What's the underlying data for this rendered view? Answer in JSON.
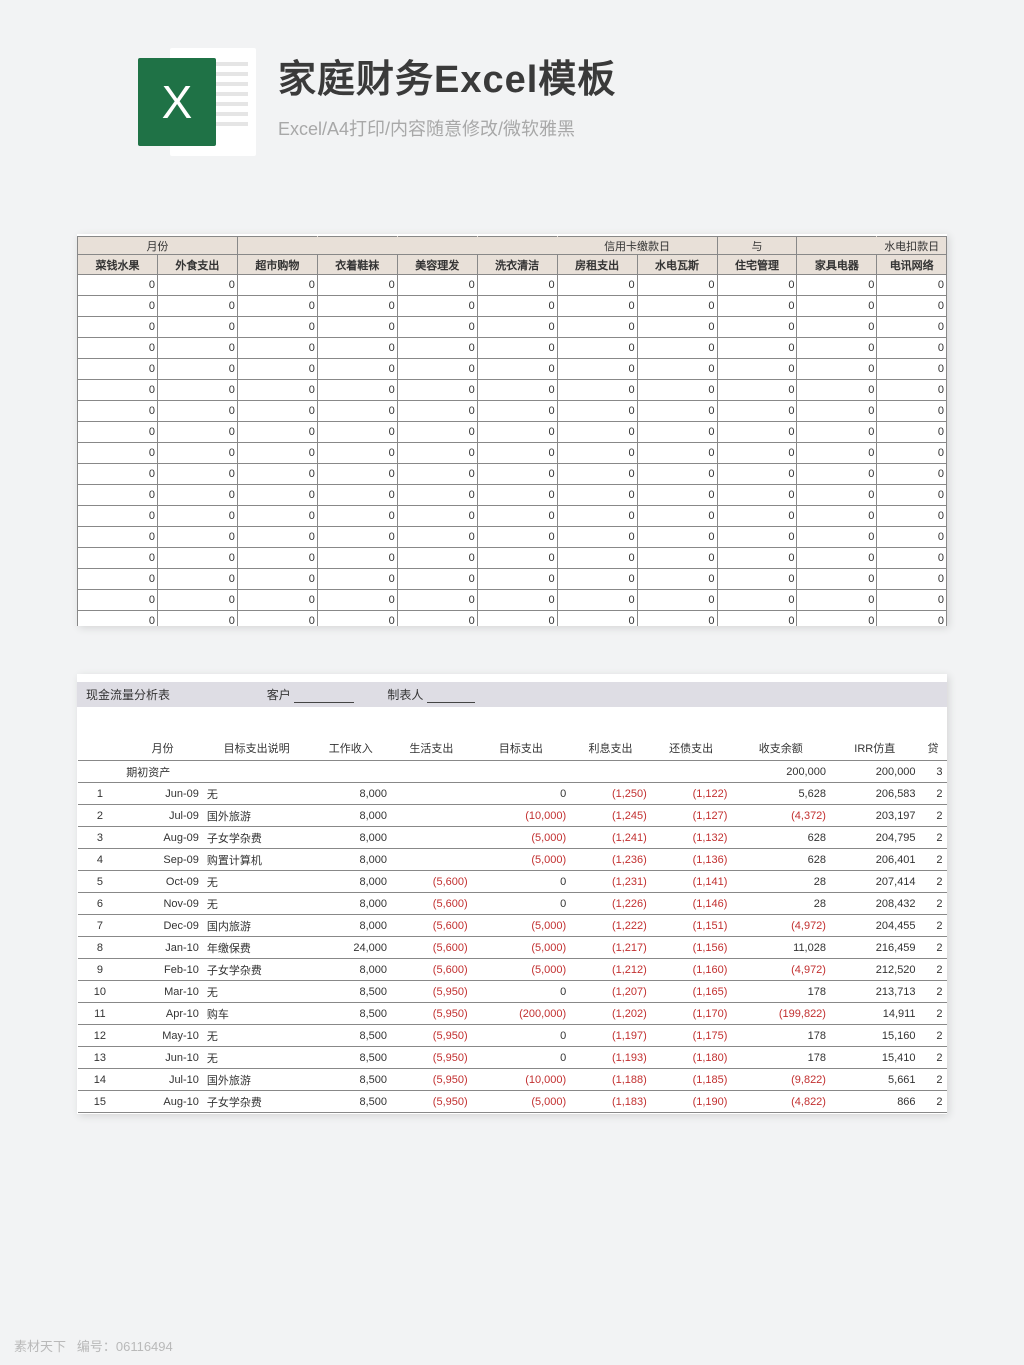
{
  "header": {
    "title": "家庭财务Excel模板",
    "subtitle": "Excel/A4打印/内容随意修改/微软雅黑"
  },
  "sheet1": {
    "top_labels": {
      "month": "月份",
      "credit_due": "信用卡缴款日",
      "and": "与",
      "util_due": "水电扣款日"
    },
    "columns": [
      "菜钱水果",
      "外食支出",
      "超市购物",
      "衣着鞋袜",
      "美容理发",
      "洗衣清洁",
      "房租支出",
      "水电瓦斯",
      "住宅管理",
      "家具电器",
      "电讯网络"
    ],
    "rows": 17,
    "cell_value": "0"
  },
  "sheet2": {
    "title": "现金流量分析表",
    "client_label": "客户",
    "maker_label": "制表人",
    "columns": [
      "",
      "月份",
      "目标支出说明",
      "工作收入",
      "生活支出",
      "目标支出",
      "利息支出",
      "还债支出",
      "收支余额",
      "IRR仿直",
      "贷"
    ],
    "initial_row": {
      "label": "期初资产",
      "balance": "200,000",
      "irr": "200,000",
      "tail": "3"
    },
    "rows": [
      {
        "n": "1",
        "m": "Jun-09",
        "d": "无",
        "inc": "8,000",
        "liv": "",
        "tgt": "0",
        "int": "(1,250)",
        "deb": "(1,122)",
        "bal": "5,628",
        "irr": "206,583",
        "t": "2"
      },
      {
        "n": "2",
        "m": "Jul-09",
        "d": "国外旅游",
        "inc": "8,000",
        "liv": "",
        "tgt": "(10,000)",
        "int": "(1,245)",
        "deb": "(1,127)",
        "bal": "(4,372)",
        "irr": "203,197",
        "t": "2"
      },
      {
        "n": "3",
        "m": "Aug-09",
        "d": "子女学杂费",
        "inc": "8,000",
        "liv": "",
        "tgt": "(5,000)",
        "int": "(1,241)",
        "deb": "(1,132)",
        "bal": "628",
        "irr": "204,795",
        "t": "2"
      },
      {
        "n": "4",
        "m": "Sep-09",
        "d": "购置计算机",
        "inc": "8,000",
        "liv": "",
        "tgt": "(5,000)",
        "int": "(1,236)",
        "deb": "(1,136)",
        "bal": "628",
        "irr": "206,401",
        "t": "2"
      },
      {
        "n": "5",
        "m": "Oct-09",
        "d": "无",
        "inc": "8,000",
        "liv": "(5,600)",
        "tgt": "0",
        "int": "(1,231)",
        "deb": "(1,141)",
        "bal": "28",
        "irr": "207,414",
        "t": "2"
      },
      {
        "n": "6",
        "m": "Nov-09",
        "d": "无",
        "inc": "8,000",
        "liv": "(5,600)",
        "tgt": "0",
        "int": "(1,226)",
        "deb": "(1,146)",
        "bal": "28",
        "irr": "208,432",
        "t": "2"
      },
      {
        "n": "7",
        "m": "Dec-09",
        "d": "国内旅游",
        "inc": "8,000",
        "liv": "(5,600)",
        "tgt": "(5,000)",
        "int": "(1,222)",
        "deb": "(1,151)",
        "bal": "(4,972)",
        "irr": "204,455",
        "t": "2"
      },
      {
        "n": "8",
        "m": "Jan-10",
        "d": "年缴保费",
        "inc": "24,000",
        "liv": "(5,600)",
        "tgt": "(5,000)",
        "int": "(1,217)",
        "deb": "(1,156)",
        "bal": "11,028",
        "irr": "216,459",
        "t": "2"
      },
      {
        "n": "9",
        "m": "Feb-10",
        "d": "子女学杂费",
        "inc": "8,000",
        "liv": "(5,600)",
        "tgt": "(5,000)",
        "int": "(1,212)",
        "deb": "(1,160)",
        "bal": "(4,972)",
        "irr": "212,520",
        "t": "2"
      },
      {
        "n": "10",
        "m": "Mar-10",
        "d": "无",
        "inc": "8,500",
        "liv": "(5,950)",
        "tgt": "0",
        "int": "(1,207)",
        "deb": "(1,165)",
        "bal": "178",
        "irr": "213,713",
        "t": "2"
      },
      {
        "n": "11",
        "m": "Apr-10",
        "d": "购车",
        "inc": "8,500",
        "liv": "(5,950)",
        "tgt": "(200,000)",
        "int": "(1,202)",
        "deb": "(1,170)",
        "bal": "(199,822)",
        "irr": "14,911",
        "t": "2"
      },
      {
        "n": "12",
        "m": "May-10",
        "d": "无",
        "inc": "8,500",
        "liv": "(5,950)",
        "tgt": "0",
        "int": "(1,197)",
        "deb": "(1,175)",
        "bal": "178",
        "irr": "15,160",
        "t": "2"
      },
      {
        "n": "13",
        "m": "Jun-10",
        "d": "无",
        "inc": "8,500",
        "liv": "(5,950)",
        "tgt": "0",
        "int": "(1,193)",
        "deb": "(1,180)",
        "bal": "178",
        "irr": "15,410",
        "t": "2"
      },
      {
        "n": "14",
        "m": "Jul-10",
        "d": "国外旅游",
        "inc": "8,500",
        "liv": "(5,950)",
        "tgt": "(10,000)",
        "int": "(1,188)",
        "deb": "(1,185)",
        "bal": "(9,822)",
        "irr": "5,661",
        "t": "2"
      },
      {
        "n": "15",
        "m": "Aug-10",
        "d": "子女学杂费",
        "inc": "8,500",
        "liv": "(5,950)",
        "tgt": "(5,000)",
        "int": "(1,183)",
        "deb": "(1,190)",
        "bal": "(4,822)",
        "irr": "866",
        "t": "2"
      }
    ]
  },
  "watermark": {
    "site": "素材天下",
    "id_label": "编号：",
    "id": "06116494"
  }
}
